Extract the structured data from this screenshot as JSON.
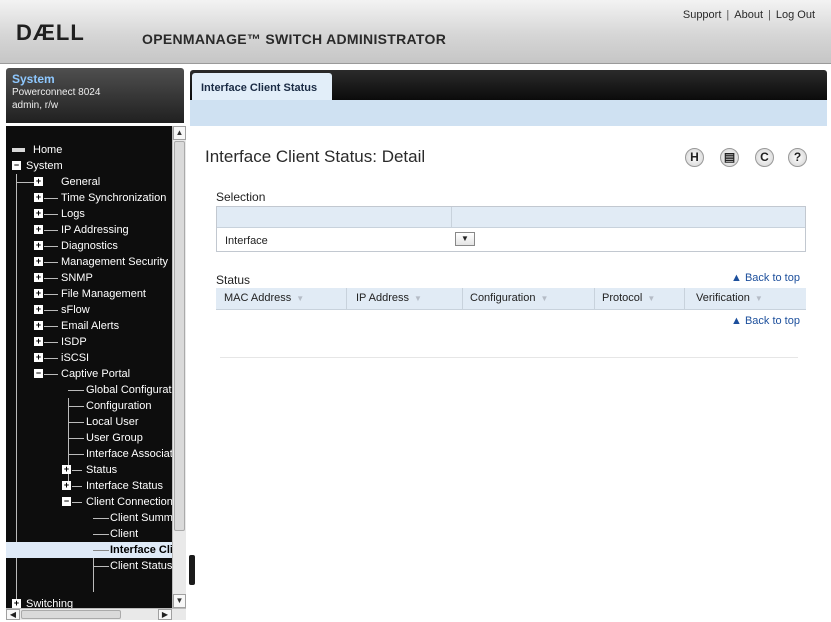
{
  "header": {
    "logo": "DÆLL",
    "app_title": "OPENMANAGE™ SWITCH ADMINISTRATOR",
    "links": [
      "Support",
      "About",
      "Log Out"
    ]
  },
  "system_info": {
    "title": "System",
    "device": "Powerconnect 8024",
    "user": "admin, r/w"
  },
  "nav": {
    "items": [
      {
        "label": "Home"
      },
      {
        "label": "System",
        "toggle": "−"
      },
      {
        "label": "General",
        "toggle": "+"
      },
      {
        "label": "Time Synchronization",
        "toggle": "+"
      },
      {
        "label": "Logs",
        "toggle": "+"
      },
      {
        "label": "IP Addressing",
        "toggle": "+"
      },
      {
        "label": "Diagnostics",
        "toggle": "+"
      },
      {
        "label": "Management Security",
        "toggle": "+"
      },
      {
        "label": "SNMP",
        "toggle": "+"
      },
      {
        "label": "File Management",
        "toggle": "+"
      },
      {
        "label": "sFlow",
        "toggle": "+"
      },
      {
        "label": "Email Alerts",
        "toggle": "+"
      },
      {
        "label": "ISDP",
        "toggle": "+"
      },
      {
        "label": "iSCSI",
        "toggle": "+"
      },
      {
        "label": "Captive Portal",
        "toggle": "−"
      },
      {
        "label": "Global Configuration"
      },
      {
        "label": "Configuration"
      },
      {
        "label": "Local User"
      },
      {
        "label": "User Group"
      },
      {
        "label": "Interface Association"
      },
      {
        "label": "Status",
        "toggle": "+"
      },
      {
        "label": "Interface Status",
        "toggle": "+"
      },
      {
        "label": "Client Connection Status",
        "toggle": "−"
      },
      {
        "label": "Client Summary"
      },
      {
        "label": "Client"
      },
      {
        "label": "Interface Client Status"
      },
      {
        "label": "Client Status"
      },
      {
        "label": "Switching",
        "toggle": "+"
      }
    ]
  },
  "tab": {
    "label": "Interface Client Status"
  },
  "page": {
    "title": "Interface Client Status: Detail",
    "tools": [
      "H",
      "▤",
      "C",
      "?"
    ]
  },
  "selection": {
    "label": "Selection",
    "interface_label": "Interface",
    "dropdown_glyph": "▼"
  },
  "status": {
    "label": "Status",
    "back_to_top": "▲ Back to top",
    "columns": [
      "MAC Address",
      "IP Address",
      "Configuration",
      "Protocol",
      "Verification"
    ],
    "sort_glyph": "▼"
  }
}
